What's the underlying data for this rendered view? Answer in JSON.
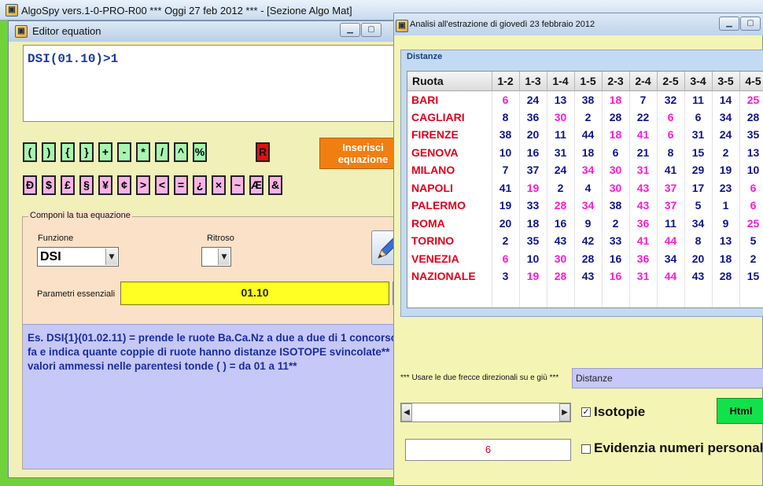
{
  "main_window": {
    "title": "AlgoSpy vers.1-0-PRO-R00  ***  Oggi 27 feb 2012  ***  - [Sezione Algo Mat]"
  },
  "editor": {
    "title": "Editor equation",
    "equation": "DSI(01.10)>1",
    "symbols_row1": [
      "(",
      ")",
      "{",
      "}",
      "+",
      "-",
      "*",
      "/",
      "^",
      "%"
    ],
    "symbol_r": "R",
    "symbols_row2": [
      "Đ",
      "$",
      "£",
      "§",
      "¥",
      "¢",
      ">",
      "<",
      "=",
      "¿",
      "×",
      "~",
      "Æ",
      "&"
    ],
    "insert_button": "Inserisci\nequazione",
    "compose_legend": "Componi la tua equazione",
    "funzione_label": "Funzione",
    "funzione_value": "DSI",
    "ritroso_label": "Ritroso",
    "ritroso_value": "",
    "params_label": "Parametri essenziali",
    "params_value": "01.10",
    "help_text": "Es. DSI{1}(01.02.11) = prende le ruote Ba.Ca.Nz a due a due di 1 concorso fa e indica quante coppie di ruote hanno distanze ISOTOPE svincolate** valori ammessi  nelle parentesi tonde ( ) = da 01 a 11**"
  },
  "analysis": {
    "title": "Analisi all'estrazione di giovedì 23 febbraio 2012",
    "group_label": "Distanze",
    "table_columns": [
      "Ruota",
      "1-2",
      "1-3",
      "1-4",
      "1-5",
      "2-3",
      "2-4",
      "2-5",
      "3-4",
      "3-5",
      "4-5"
    ],
    "table_rows": [
      {
        "ruota": "BARI",
        "values": [
          "6",
          "24",
          "13",
          "38",
          "18",
          "7",
          "32",
          "11",
          "14",
          "25"
        ],
        "pink": [
          0,
          4,
          9
        ]
      },
      {
        "ruota": "CAGLIARI",
        "values": [
          "8",
          "36",
          "30",
          "2",
          "28",
          "22",
          "6",
          "6",
          "34",
          "28"
        ],
        "pink": [
          2,
          6
        ]
      },
      {
        "ruota": "FIRENZE",
        "values": [
          "38",
          "20",
          "11",
          "44",
          "18",
          "41",
          "6",
          "31",
          "24",
          "35"
        ],
        "pink": [
          4,
          5,
          6
        ]
      },
      {
        "ruota": "GENOVA",
        "values": [
          "10",
          "16",
          "31",
          "18",
          "6",
          "21",
          "8",
          "15",
          "2",
          "13"
        ],
        "pink": []
      },
      {
        "ruota": "MILANO",
        "values": [
          "7",
          "37",
          "24",
          "34",
          "30",
          "31",
          "41",
          "29",
          "19",
          "10"
        ],
        "pink": [
          3,
          4,
          5
        ]
      },
      {
        "ruota": "NAPOLI",
        "values": [
          "41",
          "19",
          "2",
          "4",
          "30",
          "43",
          "37",
          "17",
          "23",
          "6"
        ],
        "pink": [
          1,
          4,
          5,
          6,
          9
        ]
      },
      {
        "ruota": "PALERMO",
        "values": [
          "19",
          "33",
          "28",
          "34",
          "38",
          "43",
          "37",
          "5",
          "1",
          "6"
        ],
        "pink": [
          2,
          3,
          5,
          6,
          9
        ]
      },
      {
        "ruota": "ROMA",
        "values": [
          "20",
          "18",
          "16",
          "9",
          "2",
          "36",
          "11",
          "34",
          "9",
          "25"
        ],
        "pink": [
          5,
          9
        ]
      },
      {
        "ruota": "TORINO",
        "values": [
          "2",
          "35",
          "43",
          "42",
          "33",
          "41",
          "44",
          "8",
          "13",
          "5"
        ],
        "pink": [
          5,
          6
        ]
      },
      {
        "ruota": "VENEZIA",
        "values": [
          "6",
          "10",
          "30",
          "28",
          "16",
          "36",
          "34",
          "20",
          "18",
          "2"
        ],
        "pink": [
          0,
          2,
          5
        ]
      },
      {
        "ruota": "NAZIONALE",
        "values": [
          "3",
          "19",
          "28",
          "43",
          "16",
          "31",
          "44",
          "43",
          "28",
          "15"
        ],
        "pink": [
          1,
          2,
          4,
          5,
          6
        ]
      }
    ],
    "arrows_hint": "*** Usare le due frecce direzionali su e giù ***",
    "distanze_field": "Distanze",
    "isotopie_label": "Isotopie",
    "isotopie_checked": "✓",
    "html_button": "Html",
    "value_field": "6",
    "evidenzia_label": "Evidenzia numeri personali"
  },
  "colors": {
    "city": "#e0001b",
    "value": "#10148a",
    "highlight": "#ff1ad4",
    "help_text_bg": "#c6c8f7",
    "params_bg": "#ffff21"
  }
}
